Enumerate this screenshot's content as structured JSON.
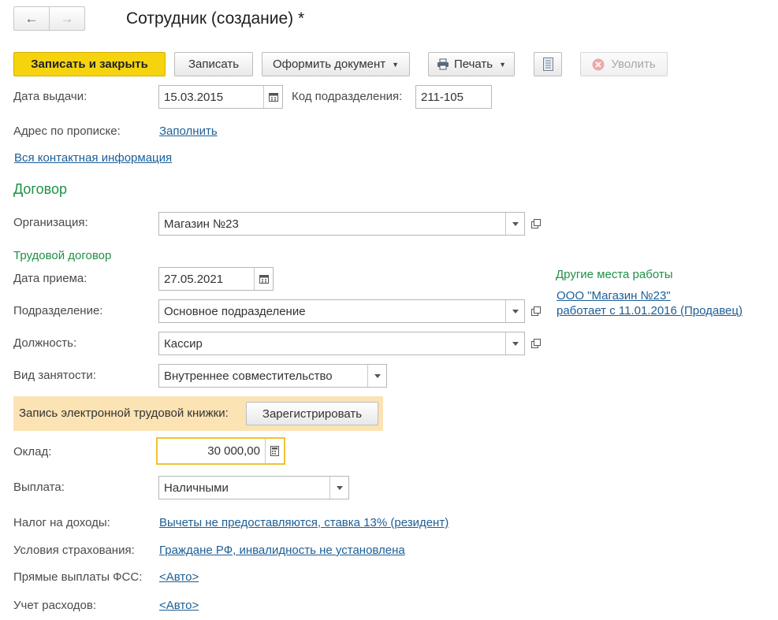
{
  "window": {
    "title": "Сотрудник (создание) *"
  },
  "toolbar": {
    "save_close": "Записать и закрыть",
    "save": "Записать",
    "make_document": "Оформить документ",
    "print": "Печать",
    "dismiss": "Уволить"
  },
  "passport": {
    "issue_date_label": "Дата выдачи:",
    "issue_date": "15.03.2015",
    "dept_code_label": "Код подразделения:",
    "dept_code": "211-105",
    "address_label": "Адрес по прописке:",
    "address_link": "Заполнить",
    "all_contacts_link": "Вся контактная информация"
  },
  "contract": {
    "section_title": "Договор",
    "org_label": "Организация:",
    "org": "Магазин №23",
    "employment_section": "Трудовой договор",
    "hire_date_label": "Дата приема:",
    "hire_date": "27.05.2021",
    "division_label": "Подразделение:",
    "division": "Основное подразделение",
    "position_label": "Должность:",
    "position": "Кассир",
    "employment_type_label": "Вид занятости:",
    "employment_type": "Внутреннее совместительство",
    "etk_label": "Запись электронной трудовой книжки:",
    "etk_button": "Зарегистрировать",
    "salary_label": "Оклад:",
    "salary": "30 000,00",
    "payment_label": "Выплата:",
    "payment": "Наличными",
    "tax_label": "Налог на доходы:",
    "tax_link": "Вычеты не предоставляются, ставка 13% (резидент)",
    "insurance_label": "Условия страхования:",
    "insurance_link": "Граждане РФ, инвалидность не установлена",
    "fss_label": "Прямые выплаты ФСС:",
    "fss_link": "<Авто>",
    "expenses_label": "Учет расходов:",
    "expenses_link": "<Авто>"
  },
  "other_jobs": {
    "title": "Другие места работы",
    "line1": "ООО \"Магазин №23\"",
    "line2": "работает с 11.01.2016 (Продавец)"
  },
  "icons": [
    "arrow-left-icon",
    "arrow-right-icon",
    "printer-icon",
    "list-icon",
    "close-circle-icon",
    "calendar-icon",
    "open-icon",
    "calculator-icon"
  ],
  "colors": {
    "primary_button": "#f5d40f",
    "section": "#1f9147",
    "link": "#1c5e96",
    "notice_bg": "#fbe3b4",
    "focus_border": "#f1c232"
  }
}
